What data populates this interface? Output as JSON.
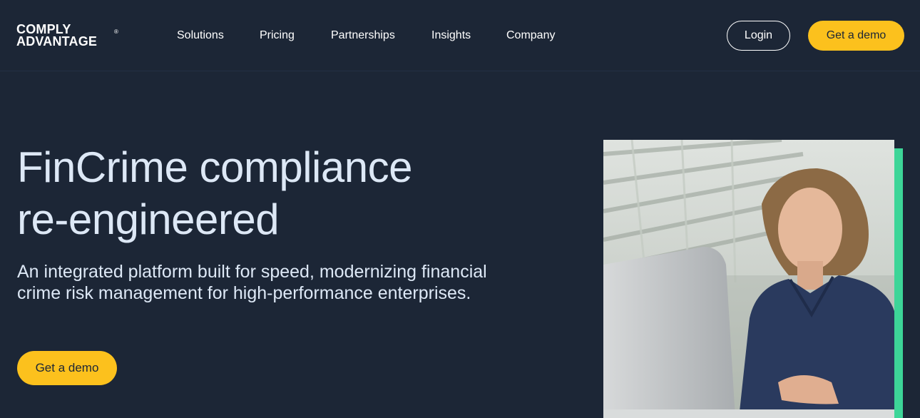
{
  "header": {
    "logo_line1": "COMPLY",
    "logo_line2": "ADVANTAGE",
    "logo_reg": "®",
    "nav": [
      {
        "label": "Solutions"
      },
      {
        "label": "Pricing"
      },
      {
        "label": "Partnerships"
      },
      {
        "label": "Insights"
      },
      {
        "label": "Company"
      }
    ],
    "login_label": "Login",
    "demo_label": "Get a demo"
  },
  "hero": {
    "title_line1": "FinCrime compliance",
    "title_line2": "re-engineered",
    "subtitle_line1": "An integrated platform built for speed, modernizing financial",
    "subtitle_line2": "crime risk management for high-performance enterprises.",
    "cta_label": "Get a demo"
  },
  "colors": {
    "background": "#1c2636",
    "accent_yellow": "#fcc11d",
    "accent_green": "#3dd598",
    "text_light": "#dde8f6"
  }
}
